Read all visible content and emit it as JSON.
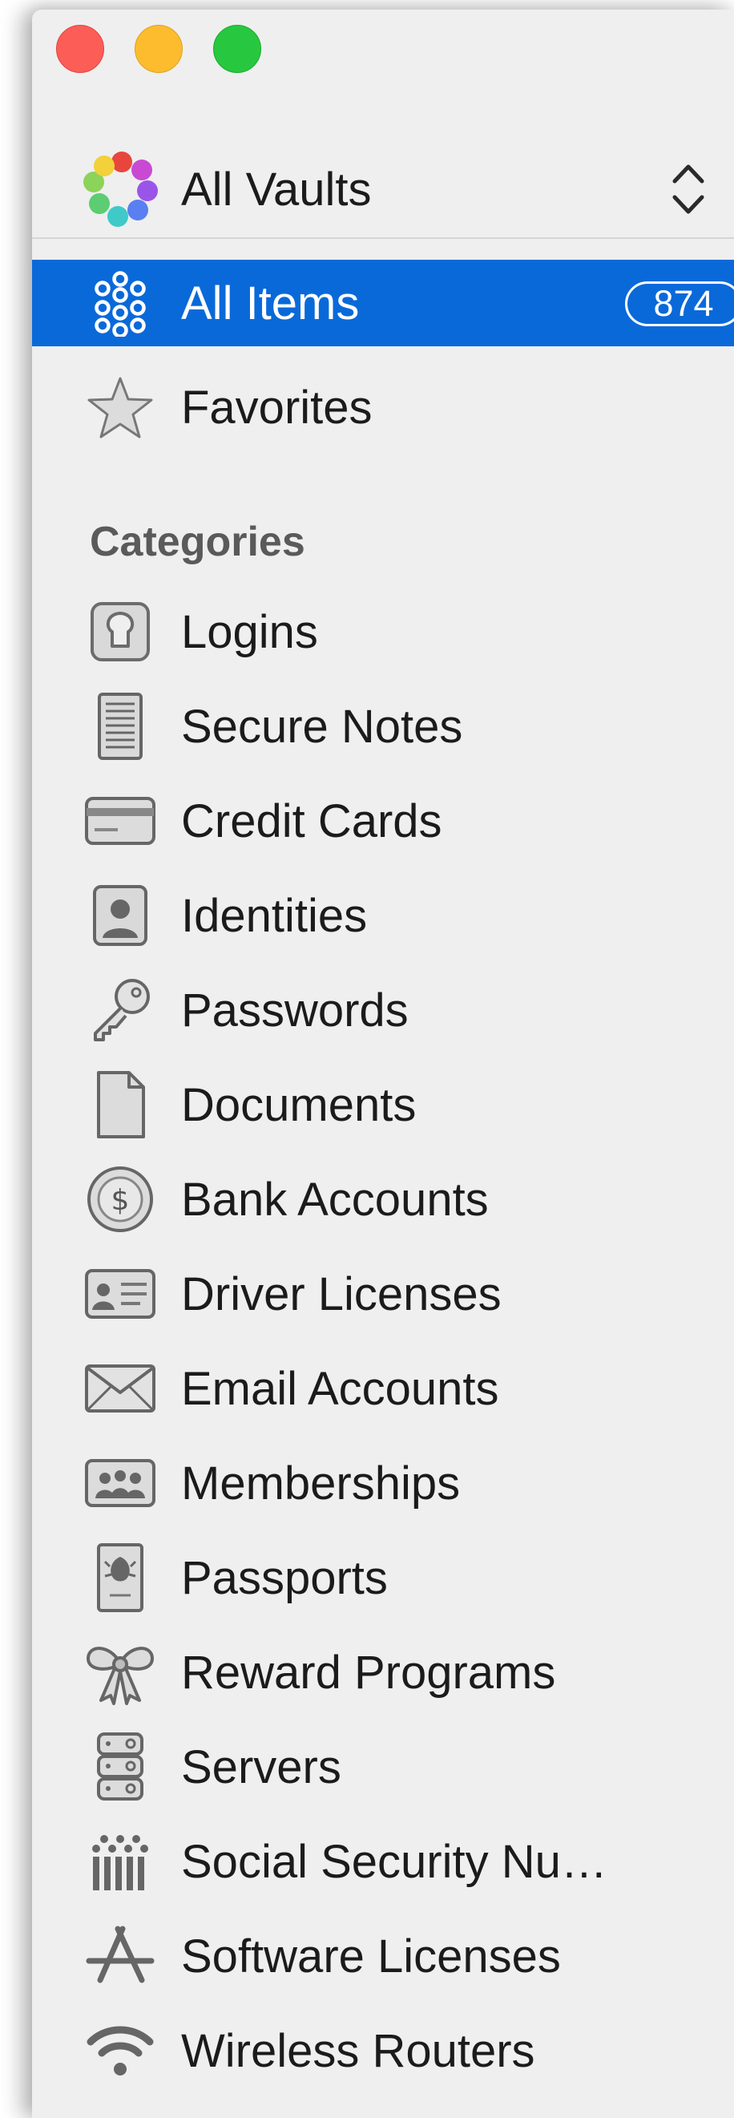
{
  "vault": {
    "label": "All Vaults"
  },
  "all_items": {
    "label": "All Items",
    "count": "874"
  },
  "favorites": {
    "label": "Favorites"
  },
  "categories_header": "Categories",
  "categories": [
    {
      "label": "Logins",
      "icon": "login-icon"
    },
    {
      "label": "Secure Notes",
      "icon": "secure-note-icon"
    },
    {
      "label": "Credit Cards",
      "icon": "credit-card-icon"
    },
    {
      "label": "Identities",
      "icon": "identity-icon"
    },
    {
      "label": "Passwords",
      "icon": "key-icon"
    },
    {
      "label": "Documents",
      "icon": "document-icon"
    },
    {
      "label": "Bank Accounts",
      "icon": "bank-coin-icon"
    },
    {
      "label": "Driver Licenses",
      "icon": "driver-license-icon"
    },
    {
      "label": "Email Accounts",
      "icon": "envelope-icon"
    },
    {
      "label": "Memberships",
      "icon": "membership-icon"
    },
    {
      "label": "Passports",
      "icon": "passport-icon"
    },
    {
      "label": "Reward Programs",
      "icon": "bow-icon"
    },
    {
      "label": "Servers",
      "icon": "server-icon"
    },
    {
      "label": "Social Security Nu…",
      "icon": "social-security-icon"
    },
    {
      "label": "Software Licenses",
      "icon": "app-store-icon"
    },
    {
      "label": "Wireless Routers",
      "icon": "wifi-icon"
    }
  ],
  "colors": {
    "selection": "#0a69d9",
    "sidebar_bg": "#efefef",
    "text": "#1b1b1b",
    "header_text": "#5a5a5a"
  }
}
